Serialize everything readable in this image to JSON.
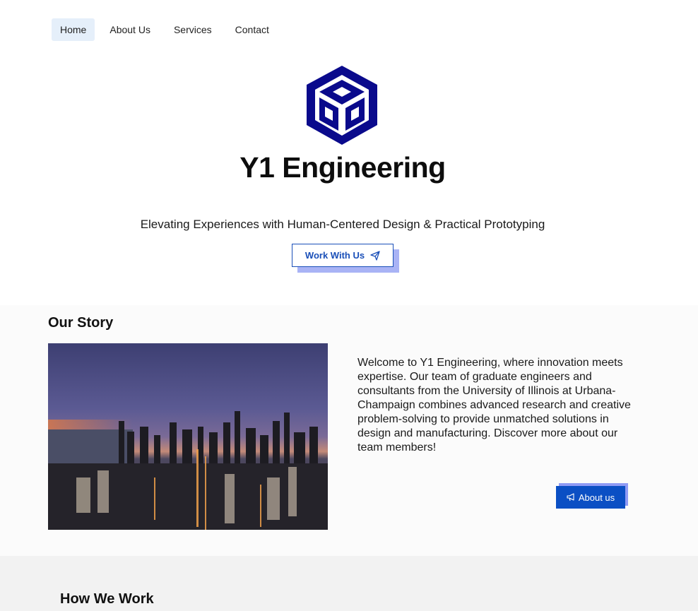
{
  "nav": {
    "items": [
      {
        "label": "Home",
        "active": true
      },
      {
        "label": "About Us",
        "active": false
      },
      {
        "label": "Services",
        "active": false
      },
      {
        "label": "Contact",
        "active": false
      }
    ]
  },
  "hero": {
    "title": "Y1 Engineering",
    "tagline": "Elevating Experiences with Human-Centered Design & Practical Prototyping",
    "cta_label": "Work With Us",
    "cta_icon": "send-icon"
  },
  "story": {
    "title": "Our Story",
    "image_alt": "city-skyline-night",
    "text": "Welcome to Y1 Engineering, where innovation meets expertise. Our team of graduate engineers and consultants from the University of Illinois at Urbana-Champaign combines advanced research and creative problem-solving to provide unmatched solutions in design and manufacturing. Discover more about our team members!",
    "button_label": "About us",
    "button_icon": "megaphone-icon"
  },
  "how": {
    "title": "How We Work"
  },
  "colors": {
    "brand": "#0a0a8c",
    "accent": "#1a4fb8",
    "button_bg": "#0b4fc4",
    "shadow": "#a9b3f5"
  }
}
